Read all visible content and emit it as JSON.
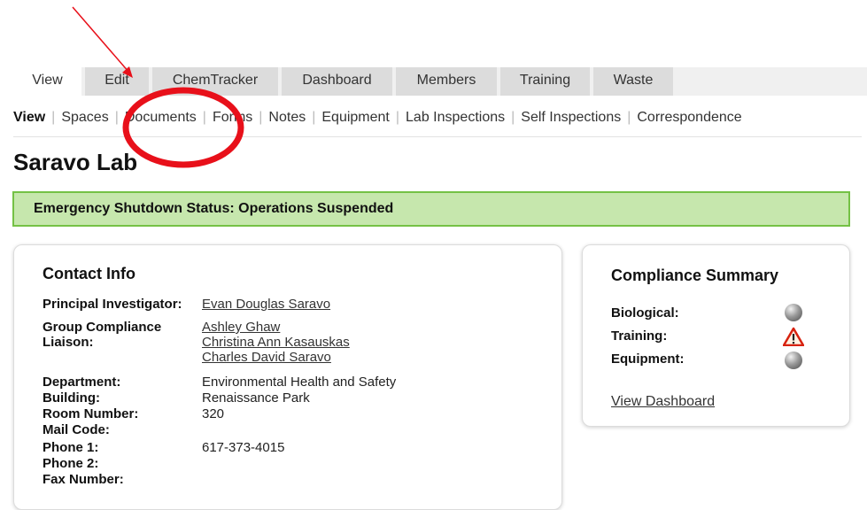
{
  "tabs": [
    "View",
    "Edit",
    "ChemTracker",
    "Dashboard",
    "Members",
    "Training",
    "Waste"
  ],
  "subnav": [
    "View",
    "Spaces",
    "Documents",
    "Forms",
    "Notes",
    "Equipment",
    "Lab Inspections",
    "Self Inspections",
    "Correspondence"
  ],
  "page_title": "Saravo Lab",
  "status_bar": "Emergency Shutdown Status: Operations Suspended",
  "contact": {
    "title": "Contact Info",
    "pi_label": "Principal Investigator:",
    "pi_value": "Evan Douglas Saravo",
    "liaison_label_1": "Group Compliance",
    "liaison_label_2": "Liaison:",
    "liaisons": [
      "Ashley Ghaw",
      "Christina Ann Kasauskas",
      "Charles David Saravo"
    ],
    "department_label": "Department:",
    "department_value": "Environmental Health and Safety",
    "building_label": "Building:",
    "building_value": "Renaissance Park",
    "room_label": "Room Number:",
    "room_value": "320",
    "mail_label": "Mail Code:",
    "phone1_label": "Phone 1:",
    "phone1_value": "617-373-4015",
    "phone2_label": "Phone 2:",
    "fax_label": "Fax Number:"
  },
  "compliance": {
    "title": "Compliance Summary",
    "rows": [
      {
        "label": "Biological:",
        "icon": "status-ball-gray"
      },
      {
        "label": "Training:",
        "icon": "warning-triangle"
      },
      {
        "label": "Equipment:",
        "icon": "status-ball-gray"
      }
    ],
    "dashboard_link": "View Dashboard"
  },
  "annotation": {
    "color": "#e8101a"
  }
}
